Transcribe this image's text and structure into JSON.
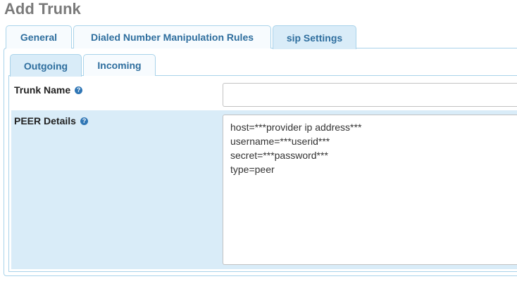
{
  "page_title": "Add Trunk",
  "tabs": [
    {
      "label": "General",
      "active": false
    },
    {
      "label": "Dialed Number Manipulation Rules",
      "active": false
    },
    {
      "label": "sip Settings",
      "active": true
    }
  ],
  "sub_tabs": [
    {
      "label": "Outgoing",
      "active": true
    },
    {
      "label": "Incoming",
      "active": false
    }
  ],
  "form": {
    "trunk_name": {
      "label": "Trunk Name",
      "value": "",
      "help_icon": "question-circle-icon"
    },
    "peer_details": {
      "label": "PEER Details",
      "help_icon": "question-circle-icon",
      "value": "host=***provider ip address***\nusername=***userid***\nsecret=***password***\ntype=peer"
    }
  },
  "colors": {
    "tab_text": "#2e6e9e",
    "tab_border": "#a9d3ea",
    "active_tab_bg": "#d9ecf8",
    "row_highlight": "#d9ecf8",
    "help_icon": "#2f76b5"
  }
}
